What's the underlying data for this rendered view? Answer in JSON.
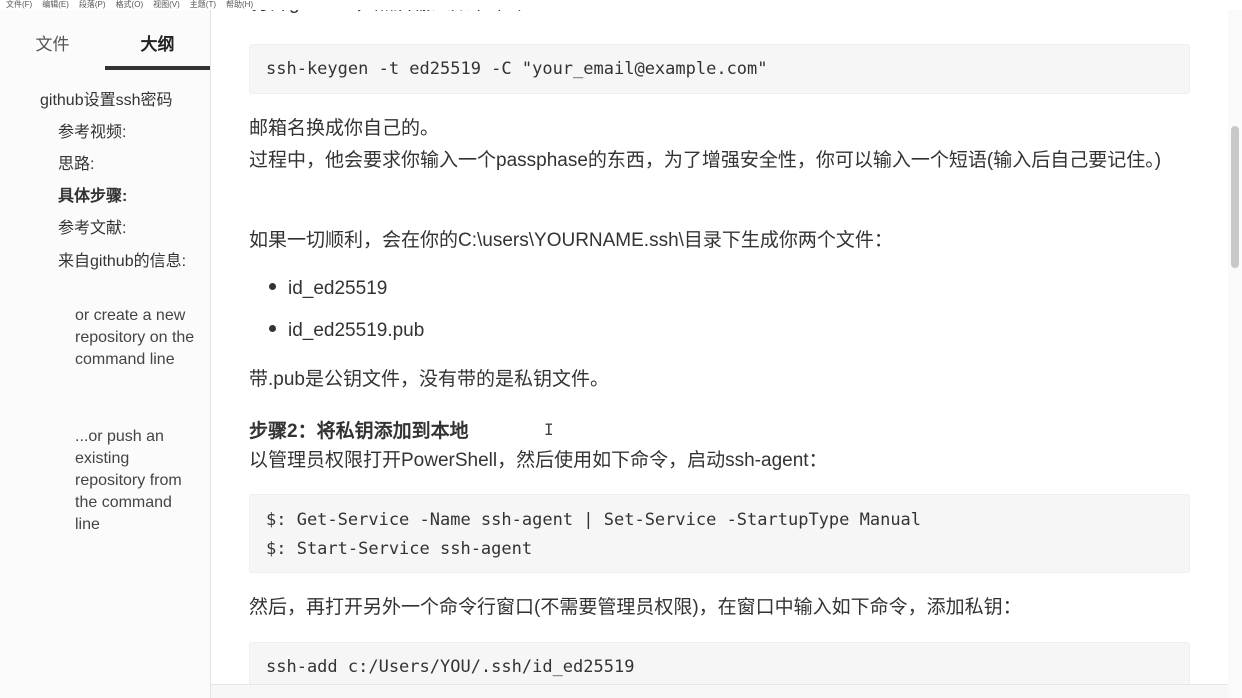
{
  "menu": [
    "文件(F)",
    "编辑(E)",
    "段落(P)",
    "格式(O)",
    "视图(V)",
    "主题(T)",
    "帮助(H)"
  ],
  "sidebar": {
    "tabs": {
      "file": "文件",
      "outline": "大纲"
    },
    "outline": [
      {
        "label": "github设置ssh密码",
        "level": 1
      },
      {
        "label": "参考视频:",
        "level": 2
      },
      {
        "label": "思路:",
        "level": 2
      },
      {
        "label": "具体步骤:",
        "level": 2,
        "active": true
      },
      {
        "label": "参考文献:",
        "level": 2
      },
      {
        "label": "来自github的信息:",
        "level": 2
      },
      {
        "label": "or create a new repository on the command line",
        "level": 3
      },
      {
        "label": "...or push an existing repository from the command line",
        "level": 3
      }
    ]
  },
  "content": {
    "cut_line": "打开git bash，然后输入如下命令：",
    "code1": "ssh-keygen -t ed25519 -C \"your_email@example.com\"",
    "p1": "邮箱名换成你自己的。",
    "p2": " 过程中，他会要求你输入一个passphase的东西，为了增强安全性，你可以输入一个短语(输入后自己要记住。)",
    "p3": "如果一切顺利，会在你的C:\\users\\YOURNAME.ssh\\目录下生成你两个文件：",
    "bullets": [
      "id_ed25519",
      "id_ed25519.pub"
    ],
    "p4": "带.pub是公钥文件，没有带的是私钥文件。",
    "heading": "步骤2：将私钥添加到本地",
    "cursor": "I",
    "p5": " 以管理员权限打开PowerShell，然后使用如下命令，启动ssh-agent：",
    "code2": [
      "$: Get-Service -Name ssh-agent | Set-Service -StartupType Manual",
      "$: Start-Service ssh-agent"
    ],
    "p6": "然后，再打开另外一个命令行窗口(不需要管理员权限)，在窗口中输入如下命令，添加私钥：",
    "code3": "ssh-add c:/Users/YOU/.ssh/id_ed25519"
  }
}
